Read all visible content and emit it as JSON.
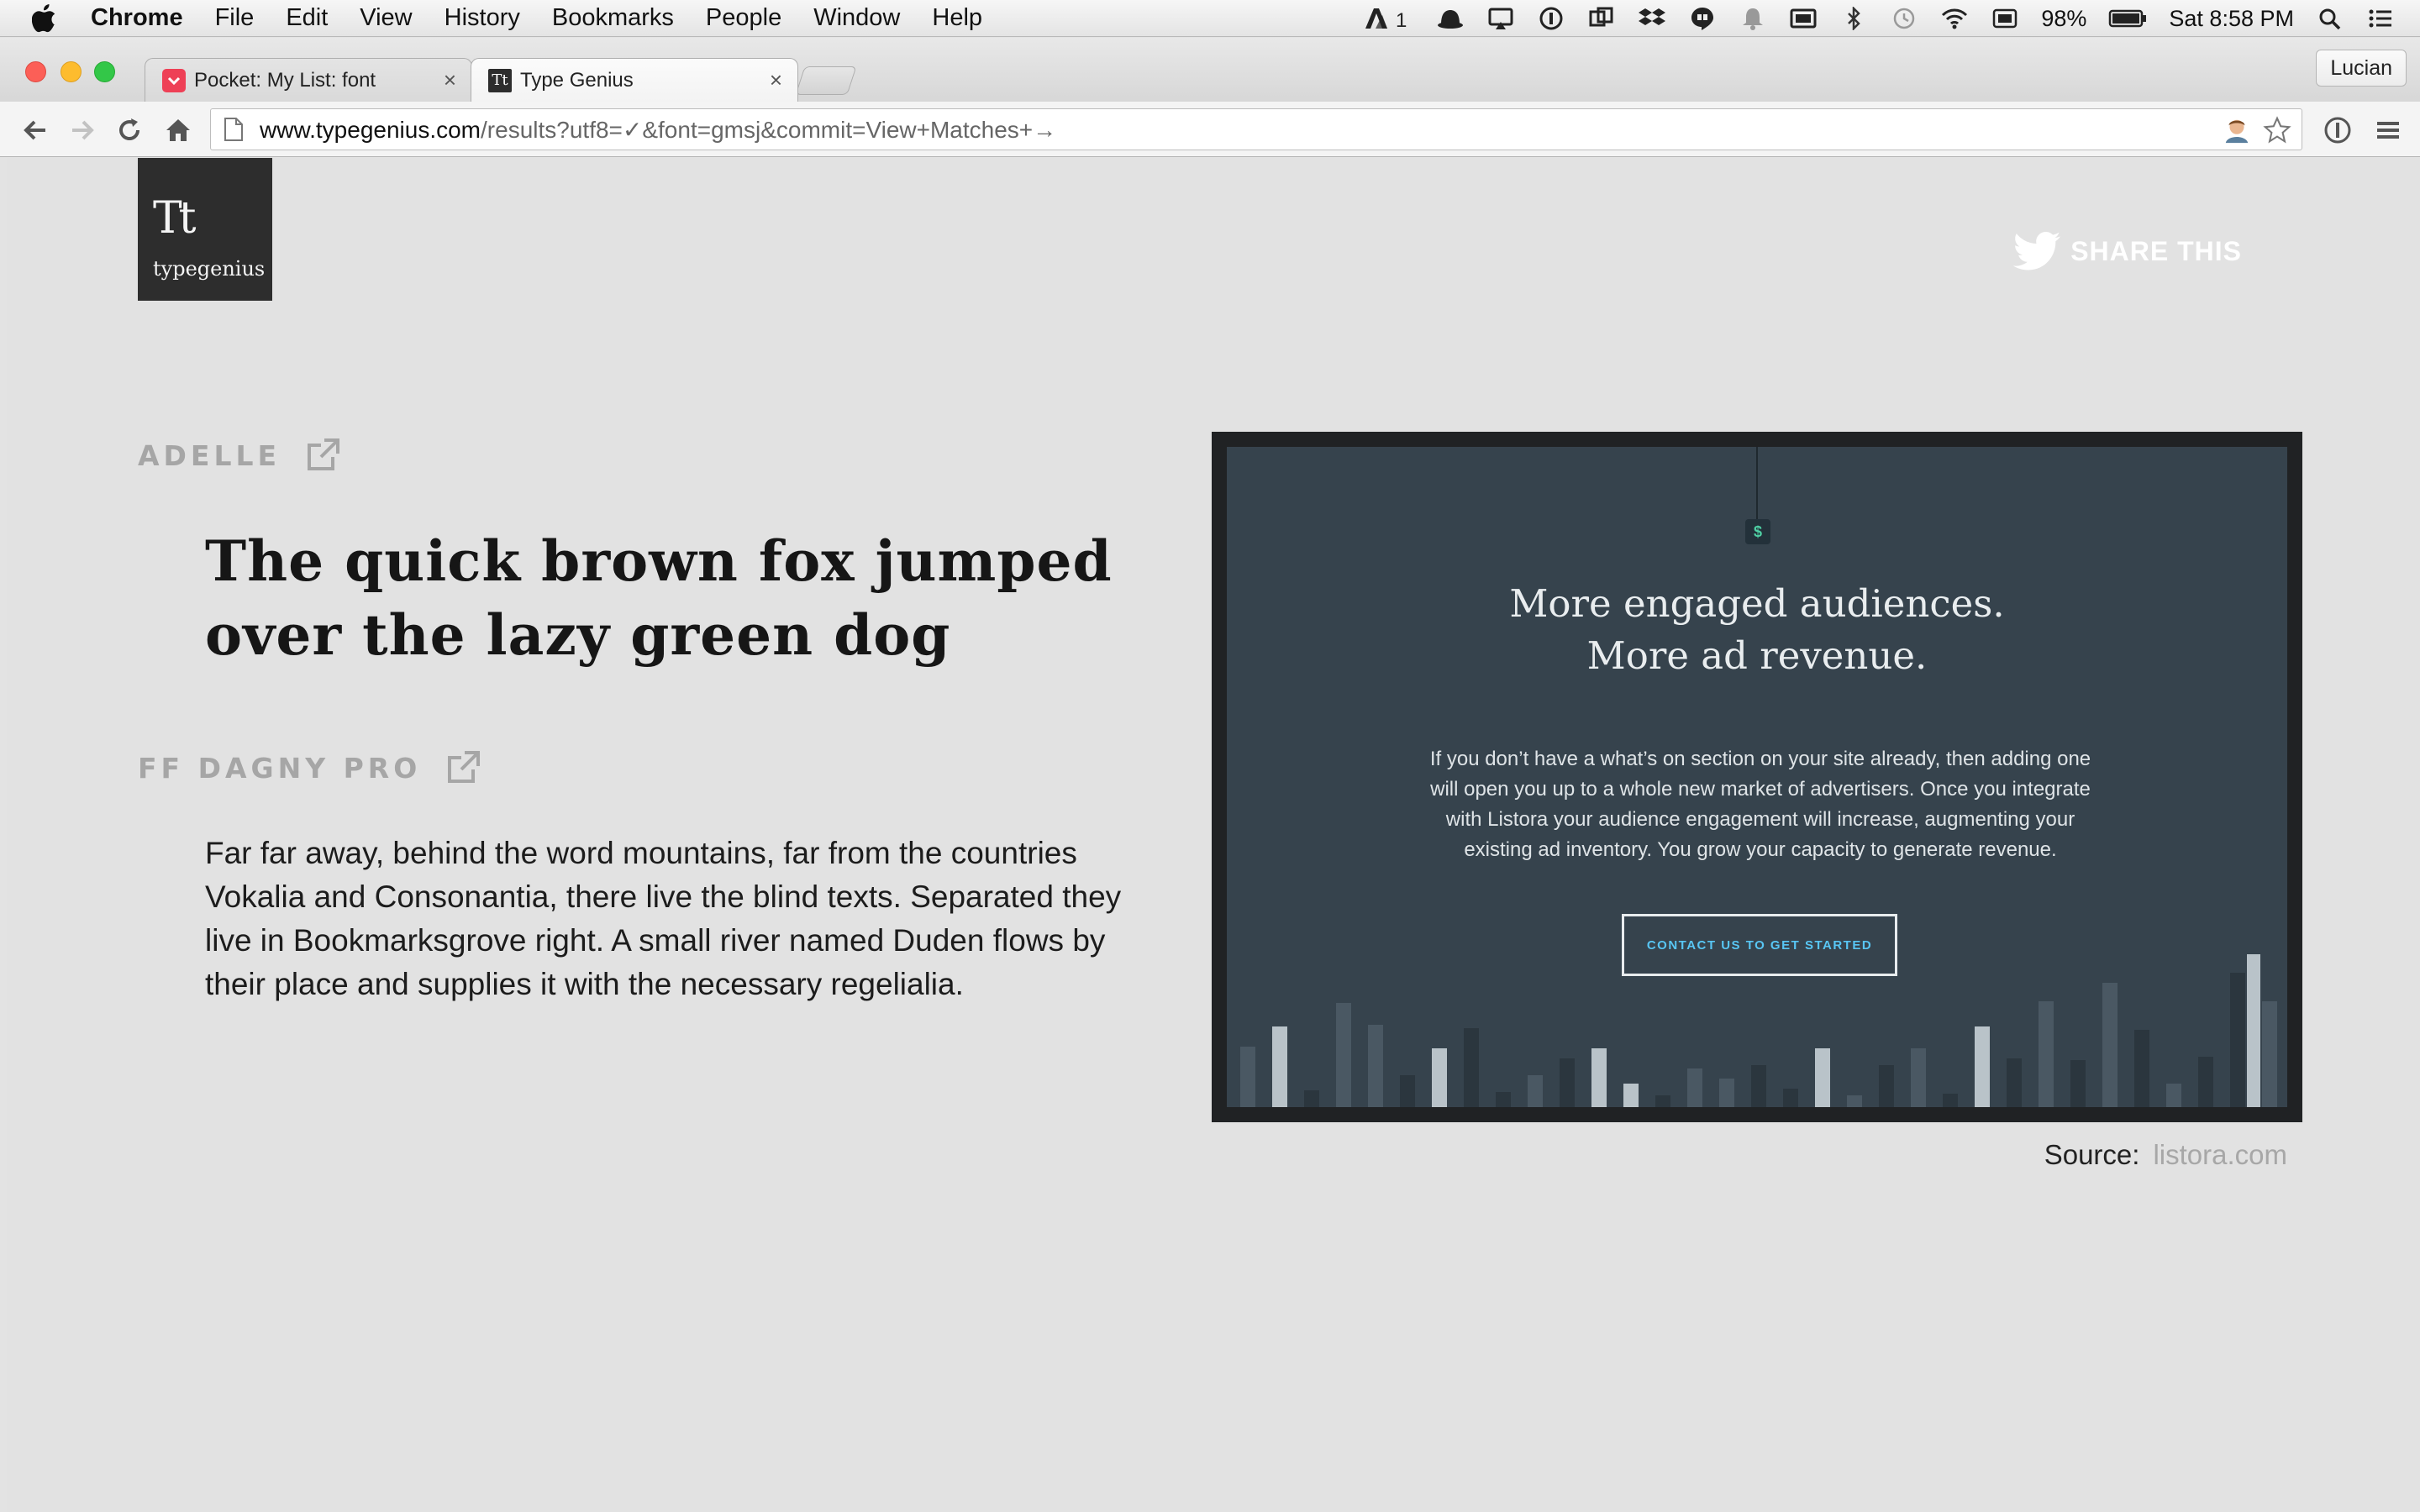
{
  "menubar": {
    "app_name": "Chrome",
    "menus": [
      "File",
      "Edit",
      "View",
      "History",
      "Bookmarks",
      "People",
      "Window",
      "Help"
    ],
    "adobe_badge": "1",
    "battery": "98%",
    "clock": "Sat 8:58 PM"
  },
  "tabs": [
    {
      "title": "Pocket: My List: font",
      "close": "×",
      "favicon": "pocket-icon",
      "active": false
    },
    {
      "title": "Type Genius",
      "close": "×",
      "favicon": "typegenius-icon",
      "active": true
    }
  ],
  "profile": {
    "name": "Lucian"
  },
  "omnibox": {
    "host": "www.typegenius.com",
    "path": "/results?utf8=✓&font=gmsj&commit=View+Matches+→"
  },
  "page": {
    "logo": {
      "mark": "Tt",
      "word": "typegenius"
    },
    "share_label": "SHARE THIS",
    "fonts": [
      {
        "name": "ADELLE",
        "sample": "The quick brown fox jumped over the lazy green dog"
      },
      {
        "name": "FF DAGNY PRO",
        "sample": "Far far away, behind the word mountains, far from the countries Vokalia and Consonantia, there live the blind texts. Separated they live in Bookmarksgrove right. A small river named Duden flows by their place and supplies it with the necessary regelialia."
      }
    ],
    "preview": {
      "tag": "$",
      "headline_1": "More engaged audiences.",
      "headline_2": "More ad revenue.",
      "body": "If you don’t have a what’s on section on your site already, then adding one will open you up to a whole new market of advertisers. Once you integrate with Listora your audience engagement will increase, augmenting your existing ad inventory. You grow your capacity to generate revenue.",
      "cta": "CONTACT US TO GET STARTED"
    },
    "source_label": "Source:",
    "source_link": "listora.com"
  },
  "colors": {
    "page_bg": "#e2e2e2",
    "preview_bg": "#36434d",
    "cta_text": "#58c6f4",
    "font_name_gray": "#a6a6a6"
  }
}
